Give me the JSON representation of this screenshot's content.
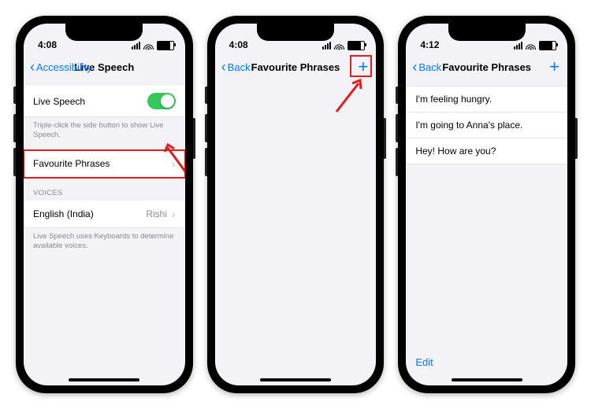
{
  "colors": {
    "ios_blue": "#007aff",
    "toggle_green": "#34c759",
    "highlight_red": "#e21b1b"
  },
  "phone1": {
    "time": "4:08",
    "back_label": "Accessibility",
    "title": "Live Speech",
    "rows": {
      "live_speech_label": "Live Speech",
      "live_speech_note": "Triple-click the side button to show Live Speech.",
      "fav_phrases_label": "Favourite Phrases",
      "voices_header": "Voices",
      "voice_lang": "English (India)",
      "voice_name": "Rishi",
      "voices_note": "Live Speech uses Keyboards to determine available voices."
    }
  },
  "phone2": {
    "time": "4:08",
    "back_label": "Back",
    "title": "Favourite Phrases"
  },
  "phone3": {
    "time": "4:12",
    "back_label": "Back",
    "title": "Favourite Phrases",
    "phrases": {
      "p1": "I'm feeling hungry.",
      "p2": "I'm going to Anna's place.",
      "p3": "Hey! How are you?"
    },
    "edit_label": "Edit"
  }
}
